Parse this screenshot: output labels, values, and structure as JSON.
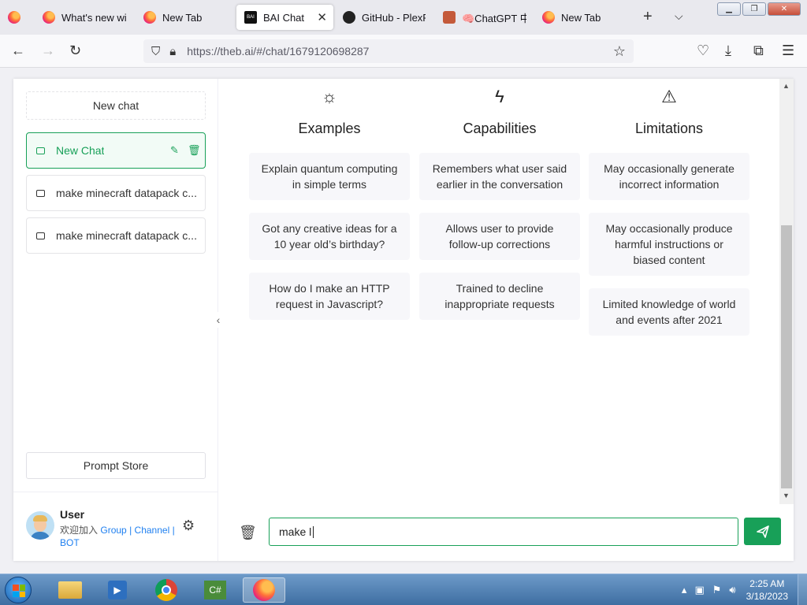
{
  "browser": {
    "tabs": [
      {
        "label": "What's new with",
        "icon": "firefox-icon"
      },
      {
        "label": "New Tab",
        "icon": "firefox-icon"
      },
      {
        "label": "BAI Chat",
        "icon": "bai-logo-icon",
        "active": true
      },
      {
        "label": "GitHub - PlexPt",
        "icon": "github-icon"
      },
      {
        "label": "🧠ChatGPT 中文",
        "icon": "chatgpt-cn-icon"
      },
      {
        "label": "New Tab",
        "icon": "firefox-icon"
      }
    ],
    "url": "https://theb.ai/#/chat/1679120698287"
  },
  "sidebar": {
    "new_chat_label": "New chat",
    "chats": [
      {
        "title": "New Chat",
        "active": true
      },
      {
        "title": "make minecraft datapack c..."
      },
      {
        "title": "make minecraft datapack c..."
      }
    ],
    "prompt_store_label": "Prompt Store",
    "user": {
      "name": "User",
      "join_text": "欢迎加入",
      "group_link": "Group",
      "sep1": "|",
      "channel_link": "Channel",
      "sep2": "|",
      "bot_link": "BOT"
    }
  },
  "main": {
    "columns": [
      {
        "title": "Examples",
        "icon": "sun-icon",
        "items": [
          "Explain quantum computing in simple terms",
          "Got any creative ideas for a 10 year old’s birthday?",
          "How do I make an HTTP request in Javascript?"
        ]
      },
      {
        "title": "Capabilities",
        "icon": "lightning-icon",
        "items": [
          "Remembers what user said earlier in the conversation",
          "Allows user to provide follow-up corrections",
          "Trained to decline inappropriate requests"
        ]
      },
      {
        "title": "Limitations",
        "icon": "warning-icon",
        "items": [
          "May occasionally generate incorrect information",
          "May occasionally produce harmful instructions or biased content",
          "Limited knowledge of world and events after 2021"
        ]
      }
    ],
    "input_value": "make l"
  },
  "taskbar": {
    "time": "2:25 AM",
    "date": "3/18/2023"
  },
  "colors": {
    "accent": "#18a058",
    "link": "#2080f0"
  }
}
